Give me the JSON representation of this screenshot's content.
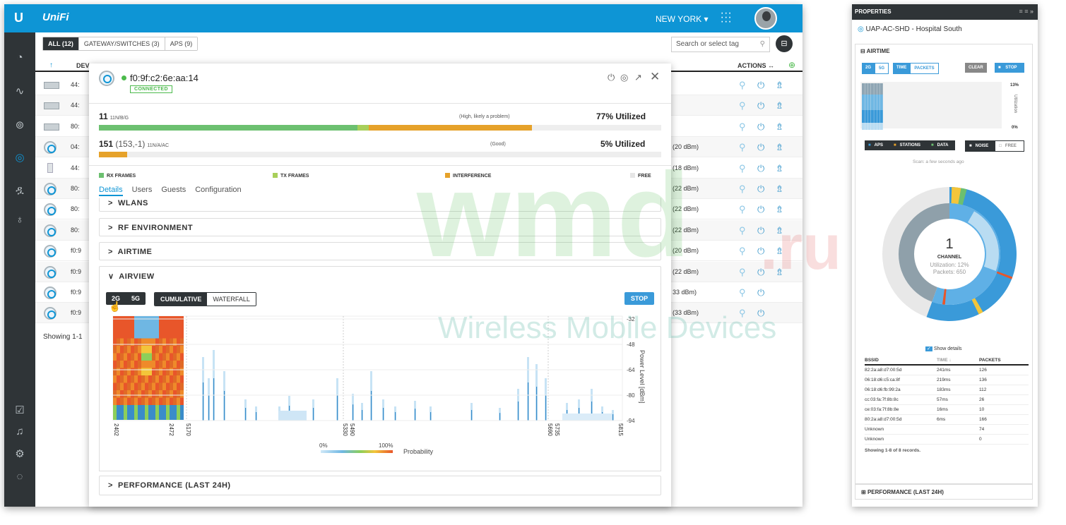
{
  "app": {
    "brand_mark": "U",
    "brand": "UniFi",
    "site": "NEW YORK"
  },
  "filters": [
    "ALL (12)",
    "GATEWAY/SWITCHES (3)",
    "APS (9)"
  ],
  "search": {
    "placeholder": "Search or select tag"
  },
  "table": {
    "col_device": "DEV",
    "col_actions": "ACTIONS",
    "rows": [
      {
        "name": "44:",
        "power": ""
      },
      {
        "name": "44:",
        "power": ""
      },
      {
        "name": "80:",
        "power": ""
      },
      {
        "name": "04:",
        "power": "(20 dBm)"
      },
      {
        "name": "44:",
        "power": "(18 dBm)"
      },
      {
        "name": "80:",
        "power": "(22 dBm)"
      },
      {
        "name": "80:",
        "power": "(22 dBm)"
      },
      {
        "name": "80:",
        "power": "(22 dBm)"
      },
      {
        "name": "f0:9",
        "power": "(20 dBm)"
      },
      {
        "name": "f0:9",
        "power": "(22 dBm)"
      },
      {
        "name": "f0:9",
        "power": "33 dBm)"
      },
      {
        "name": "f0:9",
        "power": "(33 dBm)"
      }
    ],
    "footer": "Showing 1-1"
  },
  "panel": {
    "mac": "f0:9f:c2:6e:aa:14",
    "status": "CONNECTED",
    "channels": [
      {
        "num": "11",
        "sub": "",
        "std": "11N/B/G",
        "note": "(High, likely a problem)",
        "util": "77% Utilized",
        "rx": 0.46,
        "tx": 0.02,
        "interference": 0.29
      },
      {
        "num": "151",
        "sub": "(153,-1)",
        "std": "11N/A/AC",
        "note": "(Good)",
        "util": "5% Utilized",
        "rx": 0.0,
        "tx": 0.0,
        "interference": 0.05
      }
    ],
    "legend": {
      "rx": "RX FRAMES",
      "tx": "TX FRAMES",
      "int": "INTERFERENCE",
      "free": "FREE"
    },
    "tabs": [
      "Details",
      "Users",
      "Guests",
      "Configuration"
    ],
    "sections": [
      "WLANS",
      "RF ENVIRONMENT",
      "AIRTIME",
      "AIRVIEW",
      "PERFORMANCE (LAST 24H)"
    ],
    "airview": {
      "band_2g": "2G",
      "band_5g": "5G",
      "mode_cumulative": "CUMULATIVE",
      "mode_waterfall": "WATERFALL",
      "stop": "STOP",
      "ylabel": "Power Level [dBm]",
      "yticks": [
        "-32",
        "-48",
        "-64",
        "-80",
        "-94"
      ],
      "xticks": [
        "2402",
        "2472",
        "5170",
        "5330",
        "5490",
        "5690",
        "5735",
        "5815"
      ],
      "legend_min": "0%",
      "legend_max": "100%",
      "legend_label": "Probability"
    }
  },
  "properties": {
    "title": "PROPERTIES",
    "device": "UAP-AC-SHD - Hospital South",
    "section": "AIRTIME",
    "bands": [
      "2G",
      "5G"
    ],
    "modes": [
      "TIME",
      "PACKETS"
    ],
    "clear": "CLEAR",
    "stop": "STOP",
    "hist_top": "13%",
    "hist_bottom": "0%",
    "hist_label": "Utilization",
    "legend": [
      "APS",
      "STATIONS",
      "DATA"
    ],
    "noise": "NOISE",
    "free": "FREE",
    "scan": "Scan: a few seconds ago",
    "donut_center": {
      "num": "1",
      "label": "CHANNEL",
      "util": "Utilization: 12%",
      "packets": "Packets: 650"
    },
    "show_details": "Show details",
    "table_head": [
      "BSSID",
      "TIME",
      "PACKETS"
    ],
    "rows": [
      [
        "82:2a:a8:d7:00:5d",
        "241ms",
        "126"
      ],
      [
        "06:18:d6:c5:ca:8f",
        "219ms",
        "136"
      ],
      [
        "06:18:d6:fb:99:2a",
        "183ms",
        "112"
      ],
      [
        "cc:03:fa:7f:8b:8c",
        "57ms",
        "26"
      ],
      [
        "ce:03:fa:7f:8b:8e",
        "16ms",
        "10"
      ],
      [
        "80:2a:a8:d7:00:5d",
        "6ms",
        "166"
      ],
      [
        "Unknown",
        "",
        "74"
      ],
      [
        "Unknown",
        "",
        "0"
      ]
    ],
    "footer": "Showing 1-8 of 8 records.",
    "perf": "PERFORMANCE (LAST 24H)"
  },
  "watermark": {
    "big": "wmd",
    "ru": ".ru",
    "sub": "Wireless Mobile Devices"
  },
  "colors": {
    "accent": "#0e95d5",
    "rx": "#6cc070",
    "tx": "#a8cf5a",
    "interference": "#e6a22a",
    "sidebar": "#2f3437"
  }
}
